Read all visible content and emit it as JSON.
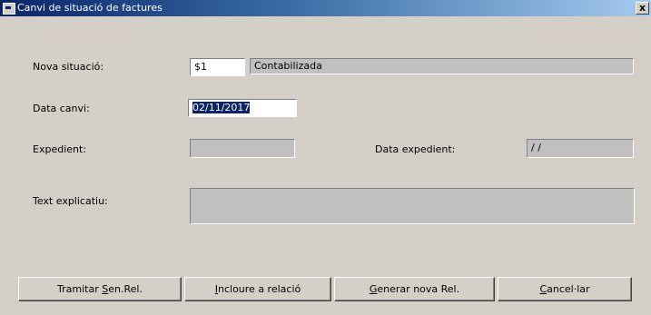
{
  "window": {
    "title": "Canvi de situació de factures",
    "close_label": "x"
  },
  "form": {
    "nova_situacio": {
      "label": "Nova situació:",
      "code": "$1",
      "description": "Contabilizada"
    },
    "data_canvi": {
      "label": "Data canvi:",
      "value": "02/11/2017"
    },
    "expedient": {
      "label": "Expedient:",
      "value": ""
    },
    "data_expedient": {
      "label": "Data expedient:",
      "value": "/ /"
    },
    "text_explicatiu": {
      "label": "Text explicatiu:",
      "value": ""
    }
  },
  "buttons": {
    "tramitar": {
      "prefix": "Tramitar ",
      "accel": "S",
      "rest": "en.Rel."
    },
    "incloure": {
      "prefix": "",
      "accel": "I",
      "rest": "ncloure a relació"
    },
    "generar": {
      "prefix": "",
      "accel": "G",
      "rest": "enerar nova Rel."
    },
    "cancel": {
      "prefix": "",
      "accel": "C",
      "rest": "ancel·lar"
    }
  }
}
